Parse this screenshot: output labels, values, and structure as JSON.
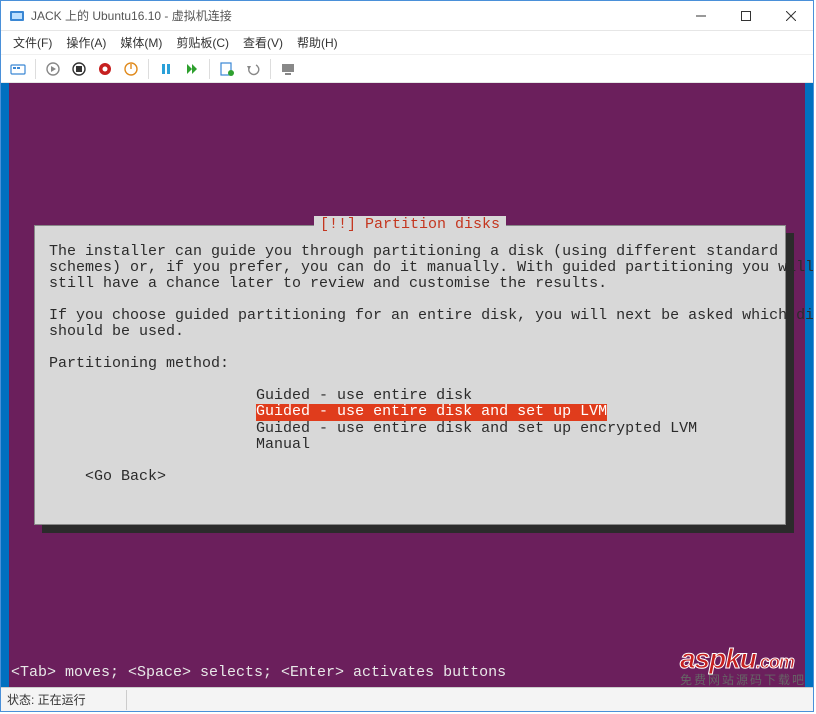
{
  "window": {
    "title": "JACK 上的 Ubuntu16.10 - 虚拟机连接"
  },
  "menubar": {
    "items": [
      {
        "label": "文件(F)"
      },
      {
        "label": "操作(A)"
      },
      {
        "label": "媒体(M)"
      },
      {
        "label": "剪贴板(C)"
      },
      {
        "label": "查看(V)"
      },
      {
        "label": "帮助(H)"
      }
    ]
  },
  "dialog": {
    "title": "[!!] Partition disks",
    "para1": "The installer can guide you through partitioning a disk (using different standard\nschemes) or, if you prefer, you can do it manually. With guided partitioning you will\nstill have a chance later to review and customise the results.",
    "para2": "If you choose guided partitioning for an entire disk, you will next be asked which disk\nshould be used.",
    "prompt": "Partitioning method:",
    "options": [
      {
        "label": "Guided - use entire disk",
        "selected": false
      },
      {
        "label": "Guided - use entire disk and set up LVM",
        "selected": true
      },
      {
        "label": "Guided - use entire disk and set up encrypted LVM",
        "selected": false
      },
      {
        "label": "Manual",
        "selected": false
      }
    ],
    "go_back": "<Go Back>"
  },
  "footer_hint": "<Tab> moves; <Space> selects; <Enter> activates buttons",
  "statusbar": {
    "label": "状态: 正在运行"
  },
  "watermark": {
    "brand": "aspku",
    "domain": ".com",
    "sub": "免费网站源码下载吧"
  }
}
